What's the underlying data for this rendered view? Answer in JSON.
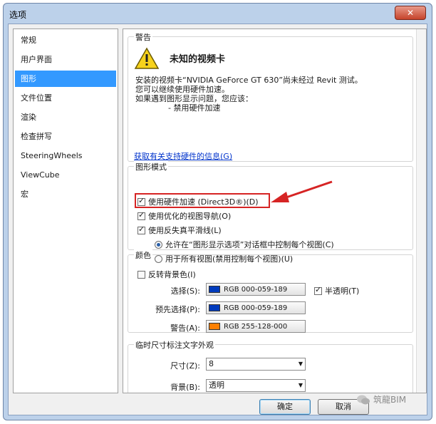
{
  "window": {
    "title": "选项",
    "close_glyph": "✕"
  },
  "nav": {
    "items": [
      {
        "label": "常规"
      },
      {
        "label": "用户界面"
      },
      {
        "label": "图形",
        "selected": true
      },
      {
        "label": "文件位置"
      },
      {
        "label": "渲染"
      },
      {
        "label": "检查拼写"
      },
      {
        "label": "SteeringWheels"
      },
      {
        "label": "ViewCube"
      },
      {
        "label": "宏"
      }
    ]
  },
  "warning": {
    "group_title": "警告",
    "icon": "warning-triangle-icon",
    "heading": "未知的视频卡",
    "lines": [
      "安装的视频卡“NVIDIA GeForce GT 630”尚未经过 Revit 测试。",
      "您可以继续使用硬件加速。",
      "如果遇到图形显示问题，您应该：",
      "- 禁用硬件加速"
    ],
    "link": "获取有关支持硬件的信息(G)"
  },
  "graphics_mode": {
    "group_title": "图形模式",
    "hardware_accel": {
      "label": "使用硬件加速 (Direct3D®)(D)",
      "checked": true
    },
    "optimized_nav": {
      "label": "使用优化的视图导航(O)",
      "checked": true
    },
    "antialias": {
      "label": "使用反失真平滑线(L)",
      "checked": true
    },
    "radio_allow": {
      "label": "允许在“图形显示选项”对话框中控制每个视图(C)",
      "selected": true
    },
    "radio_all": {
      "label": "用于所有视图(禁用控制每个视图)(U)",
      "selected": false
    }
  },
  "colors": {
    "group_title": "颜色",
    "invert_bg": {
      "label": "反转背景色(I)",
      "checked": false
    },
    "selection": {
      "label": "选择(S):",
      "value": "RGB 000-059-189",
      "color": "#003bbd"
    },
    "semi_transparent": {
      "label": "半透明(T)",
      "checked": true
    },
    "preselection": {
      "label": "预先选择(P):",
      "value": "RGB 000-059-189",
      "color": "#003bbd"
    },
    "alert": {
      "label": "警告(A):",
      "value": "RGB 255-128-000",
      "color": "#ff8000"
    }
  },
  "temp_dim": {
    "group_title": "临时尺寸标注文字外观",
    "size": {
      "label": "尺寸(Z):",
      "value": "8"
    },
    "background": {
      "label": "背景(B):",
      "value": "透明"
    }
  },
  "footer": {
    "ok": "确定",
    "cancel": "取消"
  },
  "watermark": {
    "text": "筑龍BIM"
  }
}
